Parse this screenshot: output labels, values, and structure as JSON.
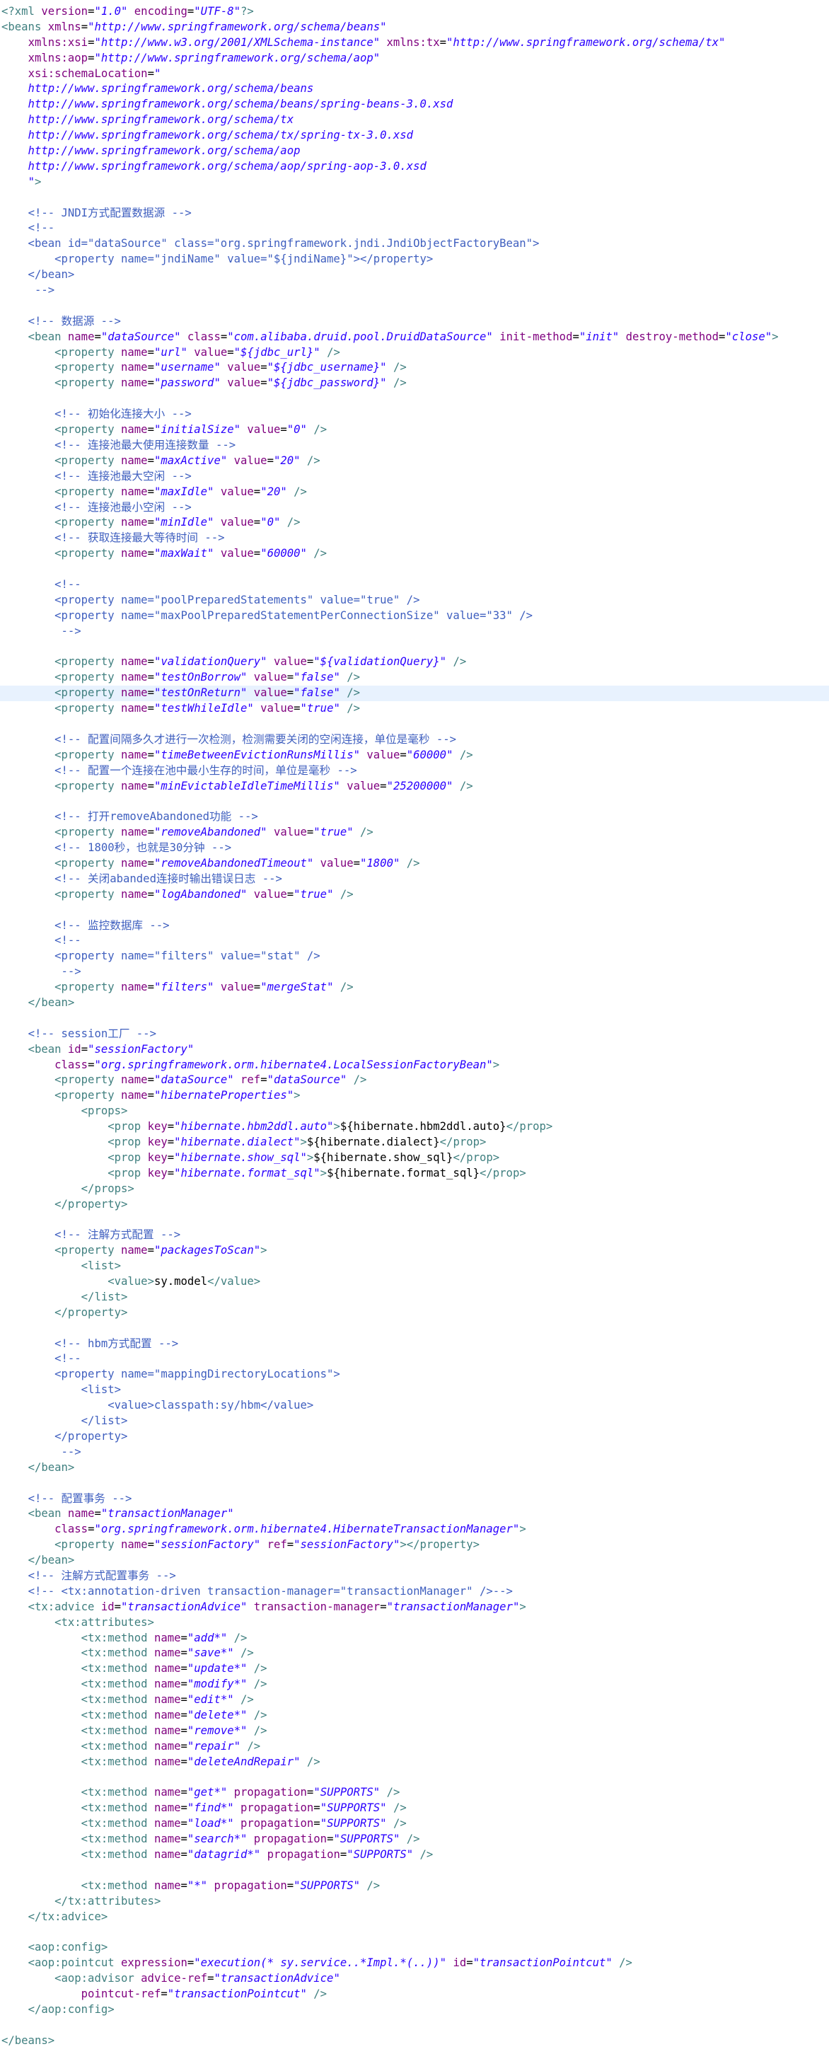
{
  "editor": {
    "language": "xml",
    "highlighted_line_index": 44,
    "colors": {
      "tag": "#3f7f7f",
      "attribute": "#7f007f",
      "value": "#2a00ff",
      "comment": "#3f5fbf",
      "text": "#000000",
      "highlight": "#e8f2fe"
    },
    "lines": [
      "<?xml version=\"1.0\" encoding=\"UTF-8\"?>",
      "<beans xmlns=\"http://www.springframework.org/schema/beans\"",
      "    xmlns:xsi=\"http://www.w3.org/2001/XMLSchema-instance\" xmlns:tx=\"http://www.springframework.org/schema/tx\"",
      "    xmlns:aop=\"http://www.springframework.org/schema/aop\"",
      "    xsi:schemaLocation=\"",
      "    http://www.springframework.org/schema/beans",
      "    http://www.springframework.org/schema/beans/spring-beans-3.0.xsd",
      "    http://www.springframework.org/schema/tx",
      "    http://www.springframework.org/schema/tx/spring-tx-3.0.xsd",
      "    http://www.springframework.org/schema/aop",
      "    http://www.springframework.org/schema/aop/spring-aop-3.0.xsd",
      "    \">",
      "",
      "    <!-- JNDI方式配置数据源 -->",
      "    <!--",
      "    <bean id=\"dataSource\" class=\"org.springframework.jndi.JndiObjectFactoryBean\">",
      "        <property name=\"jndiName\" value=\"${jndiName}\"></property>",
      "    </bean>",
      "     -->",
      "",
      "    <!-- 数据源 -->",
      "    <bean name=\"dataSource\" class=\"com.alibaba.druid.pool.DruidDataSource\" init-method=\"init\" destroy-method=\"close\">",
      "        <property name=\"url\" value=\"${jdbc_url}\" />",
      "        <property name=\"username\" value=\"${jdbc_username}\" />",
      "        <property name=\"password\" value=\"${jdbc_password}\" />",
      "",
      "        <!-- 初始化连接大小 -->",
      "        <property name=\"initialSize\" value=\"0\" />",
      "        <!-- 连接池最大使用连接数量 -->",
      "        <property name=\"maxActive\" value=\"20\" />",
      "        <!-- 连接池最大空闲 -->",
      "        <property name=\"maxIdle\" value=\"20\" />",
      "        <!-- 连接池最小空闲 -->",
      "        <property name=\"minIdle\" value=\"0\" />",
      "        <!-- 获取连接最大等待时间 -->",
      "        <property name=\"maxWait\" value=\"60000\" />",
      "",
      "        <!--",
      "        <property name=\"poolPreparedStatements\" value=\"true\" />",
      "        <property name=\"maxPoolPreparedStatementPerConnectionSize\" value=\"33\" />",
      "         -->",
      "",
      "        <property name=\"validationQuery\" value=\"${validationQuery}\" />",
      "        <property name=\"testOnBorrow\" value=\"false\" />",
      "        <property name=\"testOnReturn\" value=\"false\" />",
      "        <property name=\"testWhileIdle\" value=\"true\" />",
      "",
      "        <!-- 配置间隔多久才进行一次检测，检测需要关闭的空闲连接，单位是毫秒 -->",
      "        <property name=\"timeBetweenEvictionRunsMillis\" value=\"60000\" />",
      "        <!-- 配置一个连接在池中最小生存的时间，单位是毫秒 -->",
      "        <property name=\"minEvictableIdleTimeMillis\" value=\"25200000\" />",
      "",
      "        <!-- 打开removeAbandoned功能 -->",
      "        <property name=\"removeAbandoned\" value=\"true\" />",
      "        <!-- 1800秒，也就是30分钟 -->",
      "        <property name=\"removeAbandonedTimeout\" value=\"1800\" />",
      "        <!-- 关闭abanded连接时输出错误日志 -->",
      "        <property name=\"logAbandoned\" value=\"true\" />",
      "",
      "        <!-- 监控数据库 -->",
      "        <!--",
      "        <property name=\"filters\" value=\"stat\" />",
      "         -->",
      "        <property name=\"filters\" value=\"mergeStat\" />",
      "    </bean>",
      "",
      "    <!-- session工厂 -->",
      "    <bean id=\"sessionFactory\"",
      "        class=\"org.springframework.orm.hibernate4.LocalSessionFactoryBean\">",
      "        <property name=\"dataSource\" ref=\"dataSource\" />",
      "        <property name=\"hibernateProperties\">",
      "            <props>",
      "                <prop key=\"hibernate.hbm2ddl.auto\">${hibernate.hbm2ddl.auto}</prop>",
      "                <prop key=\"hibernate.dialect\">${hibernate.dialect}</prop>",
      "                <prop key=\"hibernate.show_sql\">${hibernate.show_sql}</prop>",
      "                <prop key=\"hibernate.format_sql\">${hibernate.format_sql}</prop>",
      "            </props>",
      "        </property>",
      "",
      "        <!-- 注解方式配置 -->",
      "        <property name=\"packagesToScan\">",
      "            <list>",
      "                <value>sy.model</value>",
      "            </list>",
      "        </property>",
      "",
      "        <!-- hbm方式配置 -->",
      "        <!--",
      "        <property name=\"mappingDirectoryLocations\">",
      "            <list>",
      "                <value>classpath:sy/hbm</value>",
      "            </list>",
      "        </property>",
      "         -->",
      "    </bean>",
      "",
      "    <!-- 配置事务 -->",
      "    <bean name=\"transactionManager\"",
      "        class=\"org.springframework.orm.hibernate4.HibernateTransactionManager\">",
      "        <property name=\"sessionFactory\" ref=\"sessionFactory\"></property>",
      "    </bean>",
      "    <!-- 注解方式配置事务 -->",
      "    <!-- <tx:annotation-driven transaction-manager=\"transactionManager\" />-->",
      "    <tx:advice id=\"transactionAdvice\" transaction-manager=\"transactionManager\">",
      "        <tx:attributes>",
      "            <tx:method name=\"add*\" />",
      "            <tx:method name=\"save*\" />",
      "            <tx:method name=\"update*\" />",
      "            <tx:method name=\"modify*\" />",
      "            <tx:method name=\"edit*\" />",
      "            <tx:method name=\"delete*\" />",
      "            <tx:method name=\"remove*\" />",
      "            <tx:method name=\"repair\" />",
      "            <tx:method name=\"deleteAndRepair\" />",
      "",
      "            <tx:method name=\"get*\" propagation=\"SUPPORTS\" />",
      "            <tx:method name=\"find*\" propagation=\"SUPPORTS\" />",
      "            <tx:method name=\"load*\" propagation=\"SUPPORTS\" />",
      "            <tx:method name=\"search*\" propagation=\"SUPPORTS\" />",
      "            <tx:method name=\"datagrid*\" propagation=\"SUPPORTS\" />",
      "",
      "            <tx:method name=\"*\" propagation=\"SUPPORTS\" />",
      "        </tx:attributes>",
      "    </tx:advice>",
      "",
      "    <aop:config>",
      "    <aop:pointcut expression=\"execution(* sy.service..*Impl.*(..))\" id=\"transactionPointcut\" />",
      "        <aop:advisor advice-ref=\"transactionAdvice\"",
      "            pointcut-ref=\"transactionPointcut\" />",
      "    </aop:config>",
      "",
      "</beans>"
    ]
  }
}
